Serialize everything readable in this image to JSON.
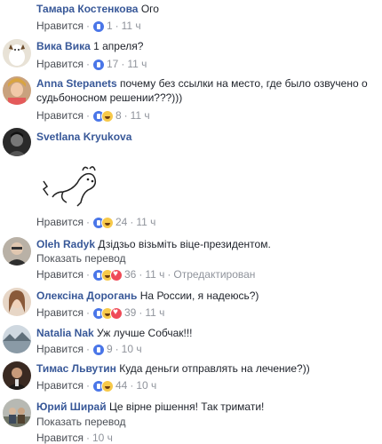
{
  "like_label": "Нравится",
  "separator": "·",
  "translate_label": "Показать перевод",
  "comments": [
    {
      "name": "Тамара Костенкова",
      "text": "Ого",
      "reacts": [
        "like"
      ],
      "count": "1",
      "time": "11 ч",
      "edited": ""
    },
    {
      "name": "Вика Вика",
      "text": "1 апреля?",
      "reacts": [
        "like"
      ],
      "count": "17",
      "time": "11 ч",
      "edited": ""
    },
    {
      "name": "Anna Stepanets",
      "text": "почему без ссылки на место, где было озвучено о судьбоносном решении???)))",
      "reacts": [
        "like",
        "haha"
      ],
      "count": "8",
      "time": "11 ч",
      "edited": ""
    },
    {
      "name": "Svetlana Kryukova",
      "text": "",
      "reacts": [
        "like",
        "haha"
      ],
      "count": "24",
      "time": "11 ч",
      "edited": ""
    },
    {
      "name": "Oleh Radyk",
      "text": "Дзідзьо візьміть віце-президентом.",
      "reacts": [
        "like",
        "haha",
        "love"
      ],
      "count": "36",
      "time": "11 ч",
      "edited": "Отредактирован"
    },
    {
      "name": "Олексіна Дорогань",
      "text": "На России, я надеюсь?)",
      "reacts": [
        "like",
        "haha",
        "love"
      ],
      "count": "39",
      "time": "11 ч",
      "edited": ""
    },
    {
      "name": "Natalia Nak",
      "text": "Уж лучше Собчак!!!",
      "reacts": [
        "like"
      ],
      "count": "9",
      "time": "10 ч",
      "edited": ""
    },
    {
      "name": "Тимас Львутин",
      "text": "Куда деньги отправлять на лечение?))",
      "reacts": [
        "like",
        "haha"
      ],
      "count": "44",
      "time": "10 ч",
      "edited": ""
    },
    {
      "name": "Юрий Ширай",
      "text": "Це вірне рішення! Так тримати!",
      "reacts": [],
      "count": "",
      "time": "10 ч",
      "edited": ""
    }
  ],
  "colors": {
    "link": "#385898",
    "meta": "#90949c",
    "like_reaction": "#4a76e8",
    "haha_reaction": "#f7c94a",
    "love_reaction": "#ef4b57"
  }
}
